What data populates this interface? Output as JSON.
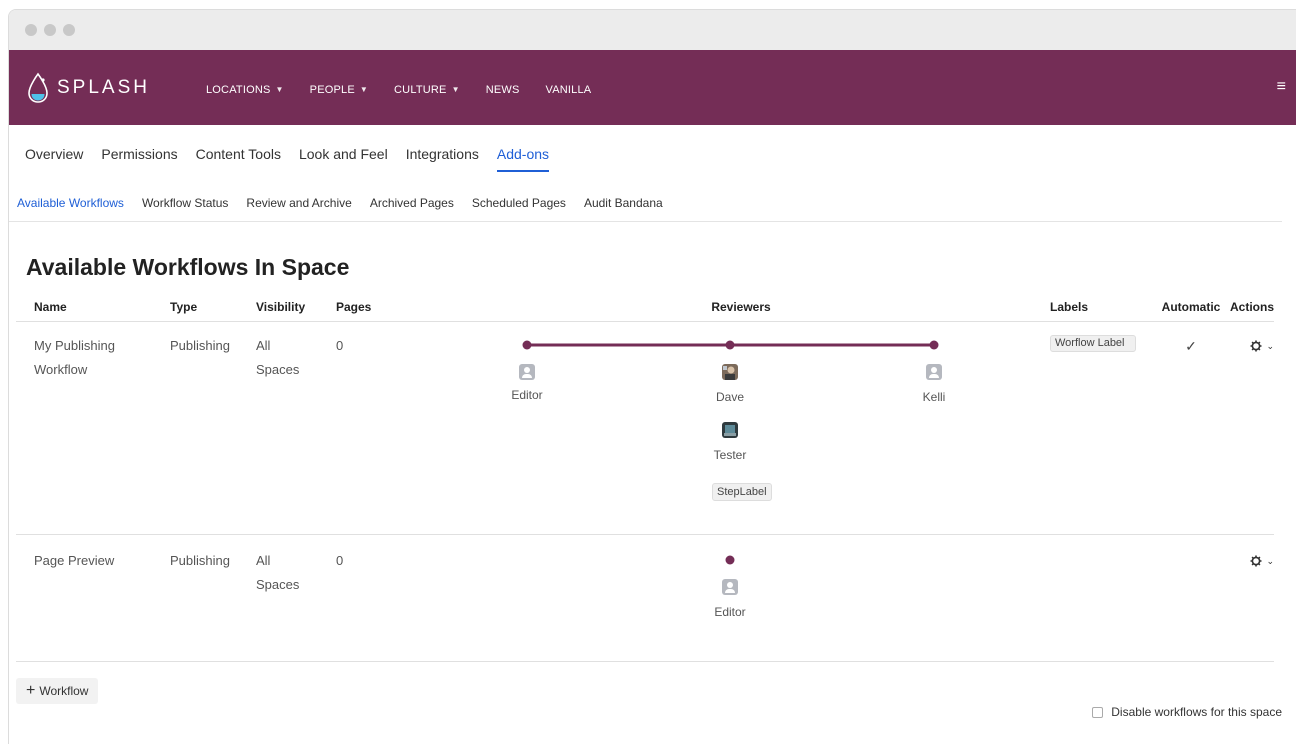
{
  "app": {
    "brand": "SPLASH",
    "nav": [
      {
        "label": "LOCATIONS",
        "dropdown": true
      },
      {
        "label": "PEOPLE",
        "dropdown": true
      },
      {
        "label": "CULTURE",
        "dropdown": true
      },
      {
        "label": "NEWS",
        "dropdown": false
      },
      {
        "label": "VANILLA",
        "dropdown": false
      }
    ],
    "colors": {
      "header": "#742d56",
      "accent": "#1f5fd6",
      "timeline": "#742d56"
    }
  },
  "settings_tabs": [
    "Overview",
    "Permissions",
    "Content Tools",
    "Look and Feel",
    "Integrations",
    "Add-ons"
  ],
  "settings_active": "Add-ons",
  "sub_tabs": [
    "Available Workflows",
    "Workflow Status",
    "Review and Archive",
    "Archived Pages",
    "Scheduled Pages",
    "Audit Bandana"
  ],
  "sub_active": "Available Workflows",
  "page_title": "Available Workflows In Space",
  "table": {
    "headers": {
      "name": "Name",
      "type": "Type",
      "visibility": "Visibility",
      "pages": "Pages",
      "reviewers": "Reviewers",
      "labels": "Labels",
      "automatic": "Automatic",
      "actions": "Actions"
    },
    "rows": [
      {
        "name": "My Publishing Workflow",
        "type": "Publishing",
        "visibility": "All Spaces",
        "pages": "0",
        "reviewers": {
          "editor": "Editor",
          "dave": "Dave",
          "tester": "Tester",
          "kelli": "Kelli",
          "step_label": "StepLabel"
        },
        "label": "Worflow Label",
        "automatic": "✓"
      },
      {
        "name": "Page Preview",
        "type": "Publishing",
        "visibility": "All Spaces",
        "pages": "0",
        "reviewers": {
          "editor": "Editor"
        },
        "label": "",
        "automatic": ""
      }
    ]
  },
  "footer": {
    "add_workflow": "Workflow",
    "disable_label": "Disable workflows for this space"
  },
  "icons": {
    "menu": "hamburger-icon",
    "actions": "gear-icon",
    "add": "plus-icon",
    "check": "check-icon"
  }
}
